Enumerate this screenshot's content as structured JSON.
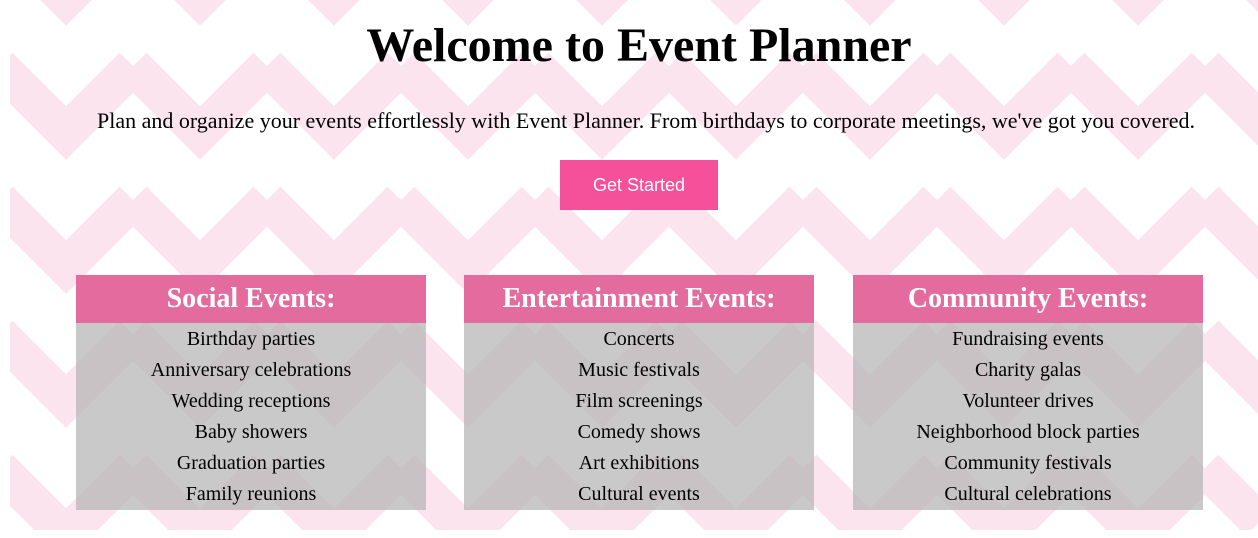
{
  "hero": {
    "title": "Welcome to Event Planner",
    "description": "Plan and organize your events effortlessly with Event Planner. From birthdays to corporate meetings, we've got you covered.",
    "cta_label": "Get Started"
  },
  "categories": [
    {
      "title": "Social Events:",
      "items": [
        "Birthday parties",
        "Anniversary celebrations",
        "Wedding receptions",
        "Baby showers",
        "Graduation parties",
        "Family reunions"
      ]
    },
    {
      "title": "Entertainment Events:",
      "items": [
        "Concerts",
        "Music festivals",
        "Film screenings",
        "Comedy shows",
        "Art exhibitions",
        "Cultural events"
      ]
    },
    {
      "title": "Community Events:",
      "items": [
        "Fundraising events",
        "Charity galas",
        "Volunteer drives",
        "Neighborhood block parties",
        "Community festivals",
        "Cultural celebrations"
      ]
    }
  ],
  "colors": {
    "chevron": "#fbe4ee",
    "button": "#f4519a",
    "card_header": "#e46b9e",
    "card_body": "#c7c7c7"
  }
}
